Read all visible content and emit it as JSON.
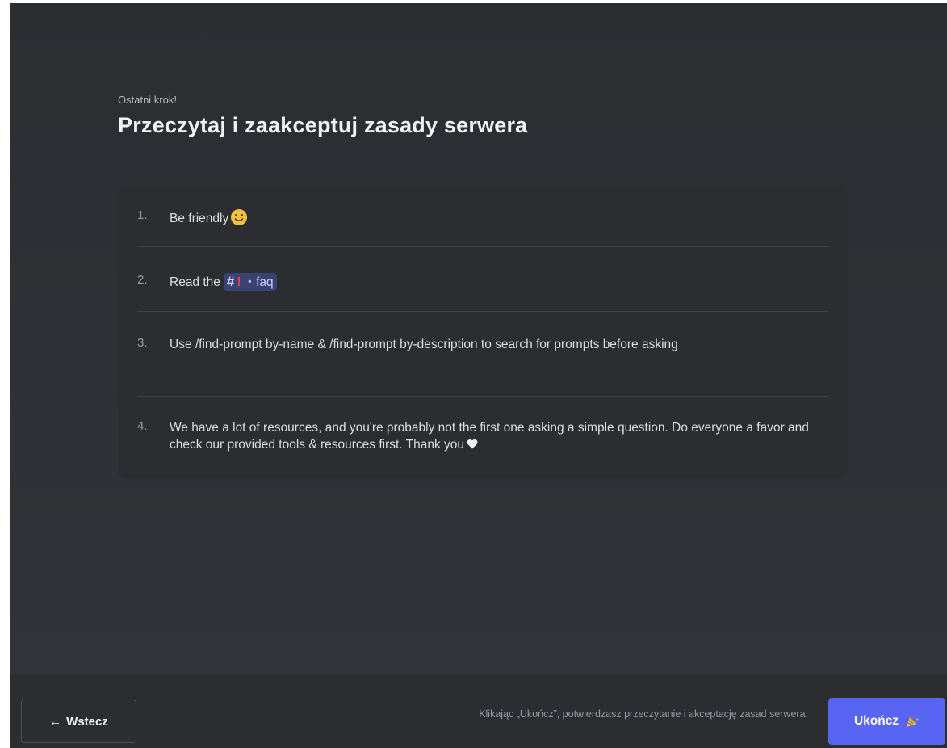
{
  "header": {
    "eyebrow": "Ostatni krok!",
    "title": "Przeczytaj i zaakceptuj zasady serwera"
  },
  "rules": [
    {
      "number": "1.",
      "text": "Be friendly",
      "icon": "smiley-emoji"
    },
    {
      "number": "2.",
      "text": "Read the",
      "channel": {
        "icon": "hash-icon",
        "emoji": "!",
        "name": "faq",
        "separator": "・"
      }
    },
    {
      "number": "3.",
      "text": "Use /find-prompt by-name & /find-prompt by-description to search for prompts before asking"
    },
    {
      "number": "4.",
      "text": "We have a lot of resources, and you're probably not the first one asking a simple question. Do everyone a favor and check our provided tools & resources first. Thank you",
      "icon": "heart-emoji"
    }
  ],
  "footer": {
    "back_label": "Wstecz",
    "back_icon": "arrow-left-icon",
    "notice": "Klikając „Ukończ”, potwierdzasz przeczytanie i akceptację zasad serwera.",
    "finish_label": "Ukończ",
    "finish_icon": "party-popper-emoji"
  },
  "colors": {
    "background": "#313338",
    "card": "#2b2d31",
    "accent": "#5865f2",
    "mention_bg": "#3c4270"
  }
}
